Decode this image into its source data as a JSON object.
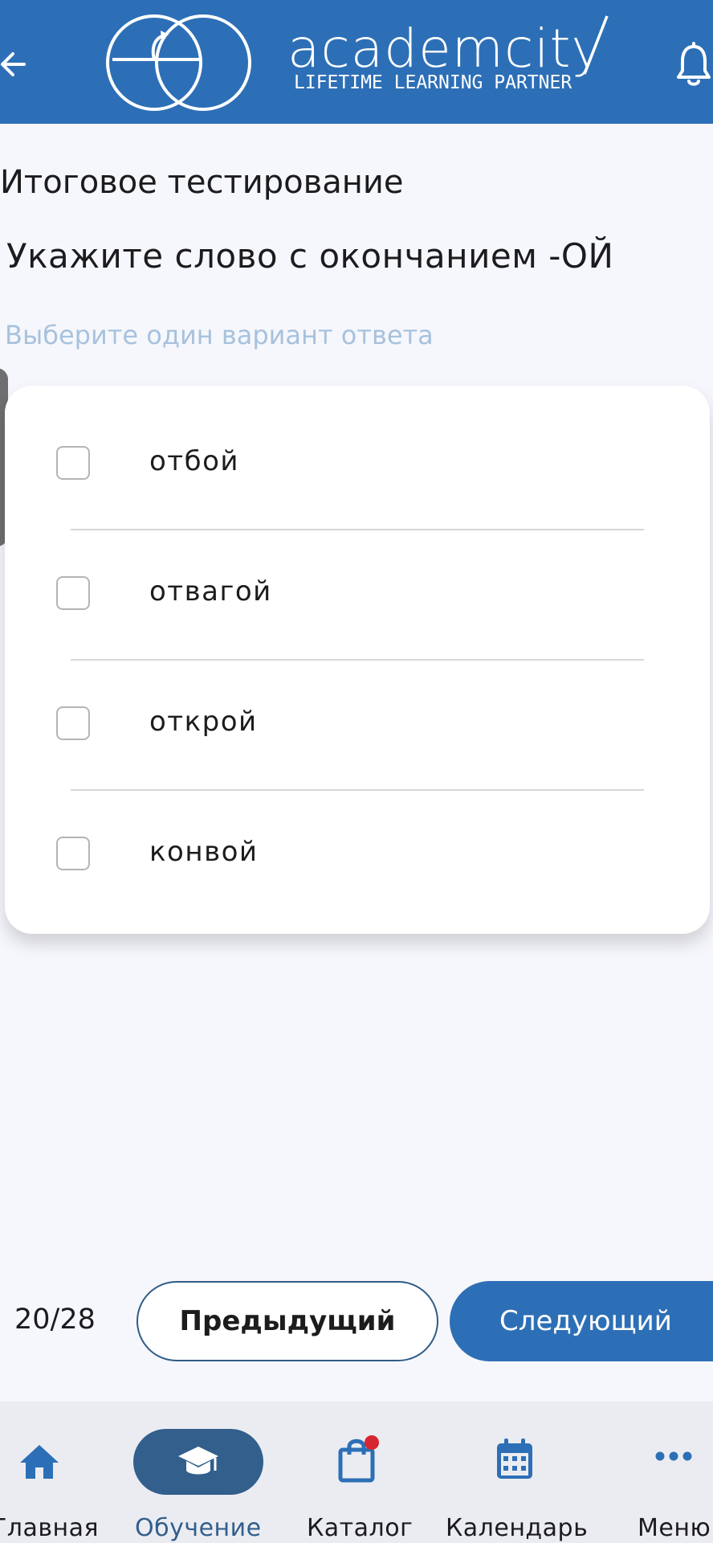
{
  "header": {
    "logo_text": "academcity",
    "logo_tagline": "LIFETIME LEARNING PARTNER"
  },
  "page_title": "Итоговое тестирование",
  "question": "Укажите слово с окончанием -ОЙ",
  "hint": "Выберите один вариант ответа",
  "options": [
    {
      "label": "отбой",
      "checked": false
    },
    {
      "label": "отвагой",
      "checked": false
    },
    {
      "label": "открой",
      "checked": false
    },
    {
      "label": "конвой",
      "checked": false
    }
  ],
  "pagination": {
    "counter": "20/28",
    "prev_label": "Предыдущий",
    "next_label": "Следующий"
  },
  "tabbar": {
    "items": [
      {
        "label": "Главная",
        "icon": "home-icon"
      },
      {
        "label": "Обучение",
        "icon": "graduation-cap-icon",
        "active": true
      },
      {
        "label": "Каталог",
        "icon": "shopping-bag-icon",
        "badge": true
      },
      {
        "label": "Календарь",
        "icon": "calendar-icon"
      },
      {
        "label": "Меню",
        "icon": "more-dots-icon"
      }
    ]
  },
  "colors": {
    "brand": "#2d6fb6",
    "active_tab": "#325f8c",
    "hint": "#a7c2dd",
    "badge": "#d6262f"
  }
}
